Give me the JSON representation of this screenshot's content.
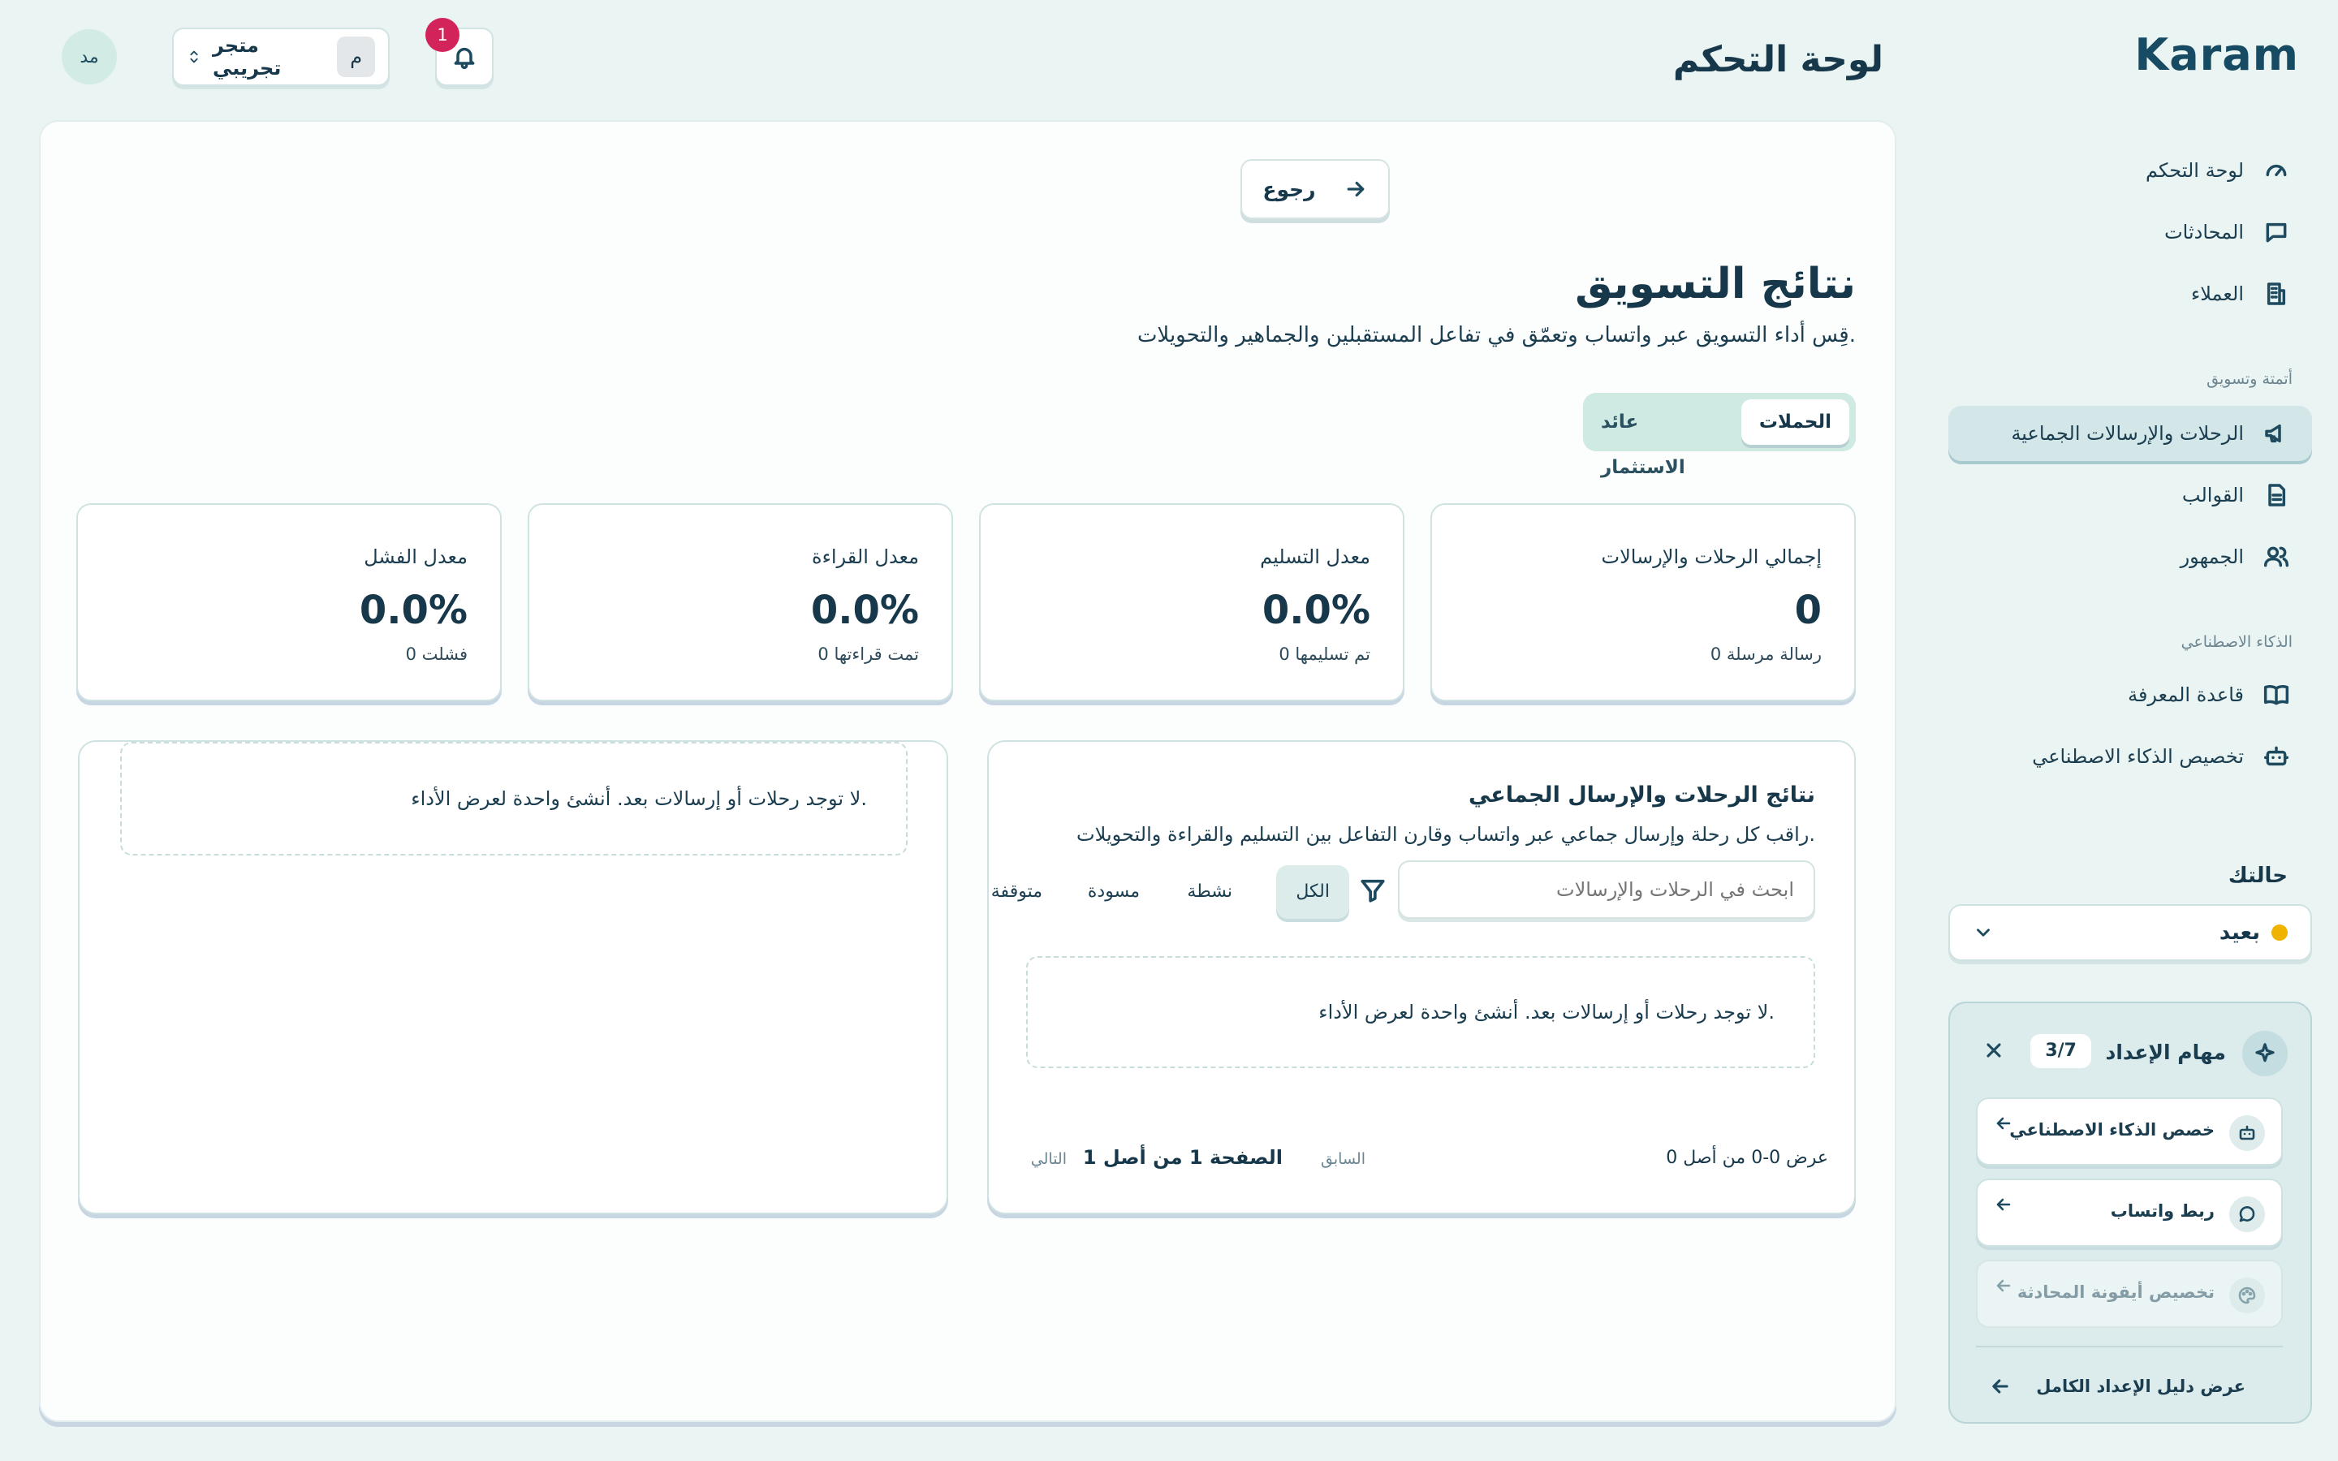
{
  "app": {
    "logo": "Karam"
  },
  "header": {
    "page_title": "لوحة التحكم",
    "avatar_initials": "مد",
    "store_name": "متجر تجريبي",
    "store_badge": "م",
    "notification_count": "1"
  },
  "sidebar": {
    "items": [
      {
        "label": "لوحة التحكم",
        "icon": "gauge-icon"
      },
      {
        "label": "المحادثات",
        "icon": "chat-icon"
      },
      {
        "label": "العملاء",
        "icon": "building-icon"
      }
    ],
    "section_automation": "أتمتة وتسويق",
    "automation_items": [
      {
        "label": "الرحلات والإرسالات الجماعية",
        "icon": "megaphone-icon",
        "active": true
      },
      {
        "label": "القوالب",
        "icon": "document-icon"
      },
      {
        "label": "الجمهور",
        "icon": "users-icon"
      }
    ],
    "section_ai": "الذكاء الاصطناعي",
    "ai_items": [
      {
        "label": "قاعدة المعرفة",
        "icon": "book-icon"
      },
      {
        "label": "تخصيص الذكاء الاصطناعي",
        "icon": "robot-icon"
      }
    ],
    "status_title": "حالتك",
    "status_value": "بعيد",
    "status_color": "#f0b400"
  },
  "onboarding": {
    "title": "مهام الإعداد",
    "count": "3/7",
    "tasks": [
      {
        "label": "خصص الذكاء الاصطناعي",
        "icon": "robot-icon"
      },
      {
        "label": "ربط واتساب",
        "icon": "chat-icon"
      },
      {
        "label": "تخصيص أيقونة المحادثة",
        "icon": "palette-icon"
      }
    ],
    "footer_link": "عرض دليل الإعداد الكامل"
  },
  "main": {
    "back_label": "رجوع",
    "title": "نتائج التسويق",
    "subtitle": "قِس أداء التسويق عبر واتساب وتعمّق في تفاعل المستقبلين والجماهير والتحويلات.",
    "tabs": [
      {
        "label": "الحملات",
        "active": true
      },
      {
        "label": "عائد الاستثمار",
        "active": false
      }
    ],
    "stats": [
      {
        "label": "إجمالي الرحلات والإرسالات",
        "value": "0",
        "sub": "0 رسالة مرسلة"
      },
      {
        "label": "معدل التسليم",
        "value": "0.0%",
        "sub": "0 تم تسليمها"
      },
      {
        "label": "معدل القراءة",
        "value": "0.0%",
        "sub": "0 تمت قراءتها"
      },
      {
        "label": "معدل الفشل",
        "value": "0.0%",
        "sub": "0 فشلت"
      }
    ],
    "results": {
      "title": "نتائج الرحلات والإرسال الجماعي",
      "subtitle": "راقب كل رحلة وإرسال جماعي عبر واتساب وقارن التفاعل بين التسليم والقراءة والتحويلات.",
      "search_placeholder": "ابحث في الرحلات والإرسالات",
      "filters": [
        "الكل",
        "نشطة",
        "مسودة",
        "متوقفة"
      ],
      "empty_text": "لا توجد رحلات أو إرسالات بعد. أنشئ واحدة لعرض الأداء.",
      "showing": "عرض 0-0 من أصل 0",
      "prev": "السابق",
      "page_text": "الصفحة 1 من أصل 1",
      "next": "التالي"
    },
    "side_empty_text": "لا توجد رحلات أو إرسالات بعد. أنشئ واحدة لعرض الأداء."
  }
}
